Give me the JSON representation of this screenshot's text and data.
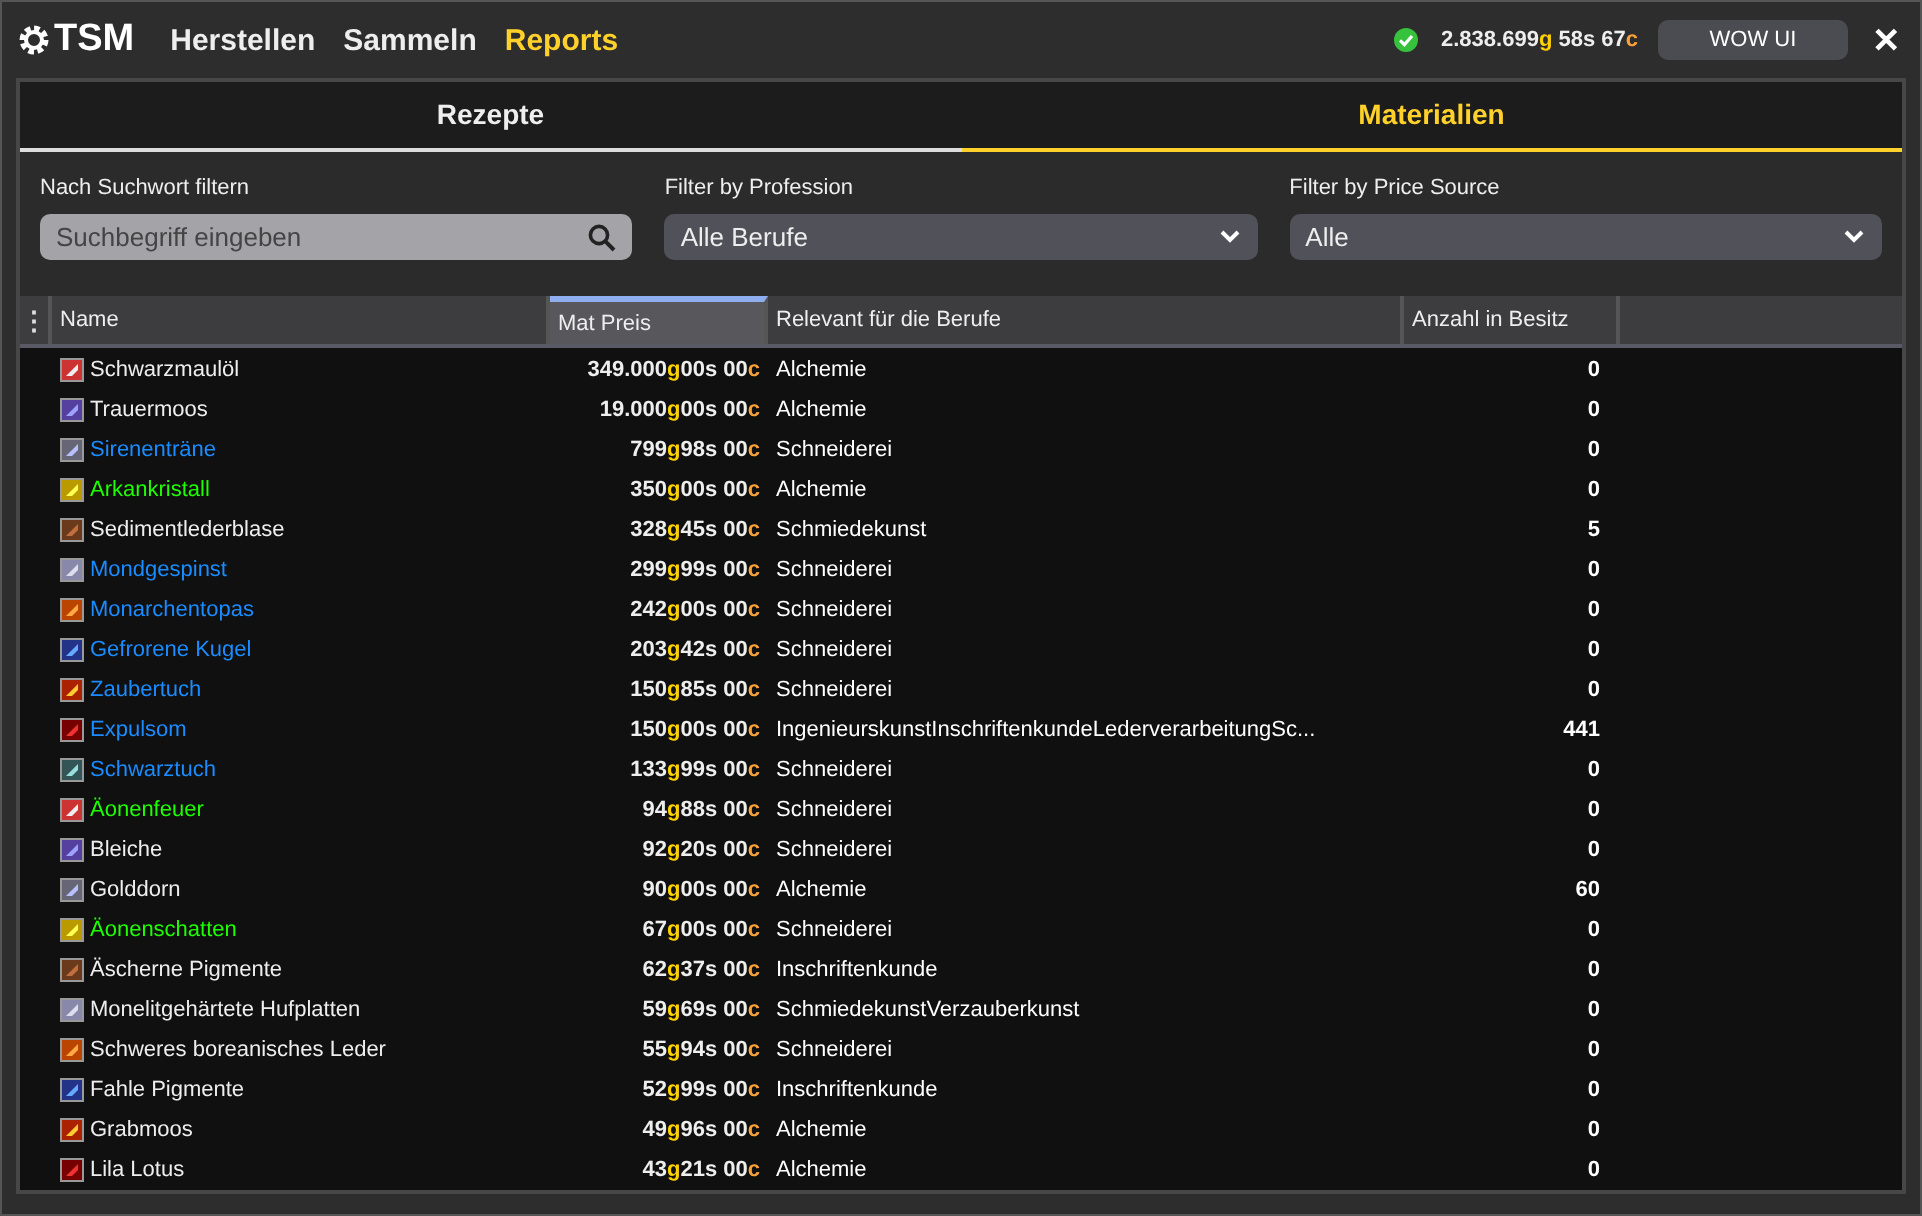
{
  "app": {
    "logo": "TSM",
    "nav": [
      {
        "label": "Herstellen",
        "selected": false
      },
      {
        "label": "Sammeln",
        "selected": false
      },
      {
        "label": "Reports",
        "selected": true
      }
    ],
    "gold": [
      {
        "text": "2.838.699",
        "kind": "amount"
      },
      {
        "text": "g",
        "kind": "gold"
      },
      {
        "text": " 58s 67",
        "kind": "amount"
      },
      {
        "text": "c",
        "kind": "copper"
      }
    ],
    "ui_button": "WOW UI",
    "close": "✕"
  },
  "tabs": [
    {
      "label": "Rezepte",
      "selected": false
    },
    {
      "label": "Materialien",
      "selected": true
    }
  ],
  "filters": [
    {
      "kind": "search",
      "label": "Nach Suchwort filtern",
      "placeholder": "Suchbegriff eingeben"
    },
    {
      "kind": "dropdown",
      "label": "Filter by Profession",
      "value": "Alle Berufe"
    },
    {
      "kind": "dropdown",
      "label": "Filter by Price Source",
      "value": "Alle"
    }
  ],
  "table": {
    "menu": "⋮",
    "columns": [
      {
        "label": "Name",
        "selected": false
      },
      {
        "label": "Mat Preis",
        "selected": true
      },
      {
        "label": "Relevant für die Berufe",
        "selected": false
      },
      {
        "label": "Anzahl in Besitz",
        "selected": false
      }
    ],
    "rows": [
      {
        "name": "Schwarzmaulöl",
        "color": "#eeeeee",
        "price": [
          {
            "text": "349.000",
            "kind": "amount"
          },
          {
            "text": "g",
            "kind": "gold"
          },
          {
            "text": " 00s 00",
            "kind": "amount"
          },
          {
            "text": "c",
            "kind": "copper"
          }
        ],
        "professions": "Alchemie",
        "owned": "0"
      },
      {
        "name": "Trauermoos",
        "color": "#eeeeee",
        "price": [
          {
            "text": "19.000",
            "kind": "amount"
          },
          {
            "text": "g",
            "kind": "gold"
          },
          {
            "text": " 00s 00",
            "kind": "amount"
          },
          {
            "text": "c",
            "kind": "copper"
          }
        ],
        "professions": "Alchemie",
        "owned": "0"
      },
      {
        "name": "Sirenenträne",
        "color": "#1a8cff",
        "price": [
          {
            "text": "799",
            "kind": "amount"
          },
          {
            "text": "g",
            "kind": "gold"
          },
          {
            "text": " 98s 00",
            "kind": "amount"
          },
          {
            "text": "c",
            "kind": "copper"
          }
        ],
        "professions": "Schneiderei",
        "owned": "0"
      },
      {
        "name": "Arkankristall",
        "color": "#1eff00",
        "price": [
          {
            "text": "350",
            "kind": "amount"
          },
          {
            "text": "g",
            "kind": "gold"
          },
          {
            "text": " 00s 00",
            "kind": "amount"
          },
          {
            "text": "c",
            "kind": "copper"
          }
        ],
        "professions": "Alchemie",
        "owned": "0"
      },
      {
        "name": "Sedimentlederblase",
        "color": "#eeeeee",
        "price": [
          {
            "text": "328",
            "kind": "amount"
          },
          {
            "text": "g",
            "kind": "gold"
          },
          {
            "text": " 45s 00",
            "kind": "amount"
          },
          {
            "text": "c",
            "kind": "copper"
          }
        ],
        "professions": "Schmiedekunst",
        "owned": "5"
      },
      {
        "name": "Mondgespinst",
        "color": "#1a8cff",
        "price": [
          {
            "text": "299",
            "kind": "amount"
          },
          {
            "text": "g",
            "kind": "gold"
          },
          {
            "text": " 99s 00",
            "kind": "amount"
          },
          {
            "text": "c",
            "kind": "copper"
          }
        ],
        "professions": "Schneiderei",
        "owned": "0"
      },
      {
        "name": "Monarchentopas",
        "color": "#1a8cff",
        "price": [
          {
            "text": "242",
            "kind": "amount"
          },
          {
            "text": "g",
            "kind": "gold"
          },
          {
            "text": " 00s 00",
            "kind": "amount"
          },
          {
            "text": "c",
            "kind": "copper"
          }
        ],
        "professions": "Schneiderei",
        "owned": "0"
      },
      {
        "name": "Gefrorene Kugel",
        "color": "#1a8cff",
        "price": [
          {
            "text": "203",
            "kind": "amount"
          },
          {
            "text": "g",
            "kind": "gold"
          },
          {
            "text": " 42s 00",
            "kind": "amount"
          },
          {
            "text": "c",
            "kind": "copper"
          }
        ],
        "professions": "Schneiderei",
        "owned": "0"
      },
      {
        "name": "Zaubertuch",
        "color": "#1a8cff",
        "price": [
          {
            "text": "150",
            "kind": "amount"
          },
          {
            "text": "g",
            "kind": "gold"
          },
          {
            "text": " 85s 00",
            "kind": "amount"
          },
          {
            "text": "c",
            "kind": "copper"
          }
        ],
        "professions": "Schneiderei",
        "owned": "0"
      },
      {
        "name": "Expulsom",
        "color": "#1a8cff",
        "price": [
          {
            "text": "150",
            "kind": "amount"
          },
          {
            "text": "g",
            "kind": "gold"
          },
          {
            "text": " 00s 00",
            "kind": "amount"
          },
          {
            "text": "c",
            "kind": "copper"
          }
        ],
        "professions": "IngenieurskunstInschriftenkundeLederverarbeitungSc...",
        "owned": "441"
      },
      {
        "name": "Schwarztuch",
        "color": "#1a8cff",
        "price": [
          {
            "text": "133",
            "kind": "amount"
          },
          {
            "text": "g",
            "kind": "gold"
          },
          {
            "text": " 99s 00",
            "kind": "amount"
          },
          {
            "text": "c",
            "kind": "copper"
          }
        ],
        "professions": "Schneiderei",
        "owned": "0"
      },
      {
        "name": "Äonenfeuer",
        "color": "#1eff00",
        "price": [
          {
            "text": "94",
            "kind": "amount"
          },
          {
            "text": "g",
            "kind": "gold"
          },
          {
            "text": " 88s 00",
            "kind": "amount"
          },
          {
            "text": "c",
            "kind": "copper"
          }
        ],
        "professions": "Schneiderei",
        "owned": "0"
      },
      {
        "name": "Bleiche",
        "color": "#eeeeee",
        "price": [
          {
            "text": "92",
            "kind": "amount"
          },
          {
            "text": "g",
            "kind": "gold"
          },
          {
            "text": " 20s 00",
            "kind": "amount"
          },
          {
            "text": "c",
            "kind": "copper"
          }
        ],
        "professions": "Schneiderei",
        "owned": "0"
      },
      {
        "name": "Golddorn",
        "color": "#eeeeee",
        "price": [
          {
            "text": "90",
            "kind": "amount"
          },
          {
            "text": "g",
            "kind": "gold"
          },
          {
            "text": " 00s 00",
            "kind": "amount"
          },
          {
            "text": "c",
            "kind": "copper"
          }
        ],
        "professions": "Alchemie",
        "owned": "60"
      },
      {
        "name": "Äonenschatten",
        "color": "#1eff00",
        "price": [
          {
            "text": "67",
            "kind": "amount"
          },
          {
            "text": "g",
            "kind": "gold"
          },
          {
            "text": " 00s 00",
            "kind": "amount"
          },
          {
            "text": "c",
            "kind": "copper"
          }
        ],
        "professions": "Schneiderei",
        "owned": "0"
      },
      {
        "name": "Äscherne Pigmente",
        "color": "#eeeeee",
        "price": [
          {
            "text": "62",
            "kind": "amount"
          },
          {
            "text": "g",
            "kind": "gold"
          },
          {
            "text": " 37s 00",
            "kind": "amount"
          },
          {
            "text": "c",
            "kind": "copper"
          }
        ],
        "professions": "Inschriftenkunde",
        "owned": "0"
      },
      {
        "name": "Monelitgehärtete Hufplatten",
        "color": "#eeeeee",
        "price": [
          {
            "text": "59",
            "kind": "amount"
          },
          {
            "text": "g",
            "kind": "gold"
          },
          {
            "text": " 69s 00",
            "kind": "amount"
          },
          {
            "text": "c",
            "kind": "copper"
          }
        ],
        "professions": "SchmiedekunstVerzauberkunst",
        "owned": "0"
      },
      {
        "name": "Schweres boreanisches Leder",
        "color": "#eeeeee",
        "price": [
          {
            "text": "55",
            "kind": "amount"
          },
          {
            "text": "g",
            "kind": "gold"
          },
          {
            "text": " 94s 00",
            "kind": "amount"
          },
          {
            "text": "c",
            "kind": "copper"
          }
        ],
        "professions": "Schneiderei",
        "owned": "0"
      },
      {
        "name": "Fahle Pigmente",
        "color": "#eeeeee",
        "price": [
          {
            "text": "52",
            "kind": "amount"
          },
          {
            "text": "g",
            "kind": "gold"
          },
          {
            "text": " 99s 00",
            "kind": "amount"
          },
          {
            "text": "c",
            "kind": "copper"
          }
        ],
        "professions": "Inschriftenkunde",
        "owned": "0"
      },
      {
        "name": "Grabmoos",
        "color": "#eeeeee",
        "price": [
          {
            "text": "49",
            "kind": "amount"
          },
          {
            "text": "g",
            "kind": "gold"
          },
          {
            "text": " 96s 00",
            "kind": "amount"
          },
          {
            "text": "c",
            "kind": "copper"
          }
        ],
        "professions": "Alchemie",
        "owned": "0"
      },
      {
        "name": "Lila Lotus",
        "color": "#eeeeee",
        "price": [
          {
            "text": "43",
            "kind": "amount"
          },
          {
            "text": "g",
            "kind": "gold"
          },
          {
            "text": " 21s 00",
            "kind": "amount"
          },
          {
            "text": "c",
            "kind": "copper"
          }
        ],
        "professions": "Alchemie",
        "owned": "0"
      }
    ]
  }
}
